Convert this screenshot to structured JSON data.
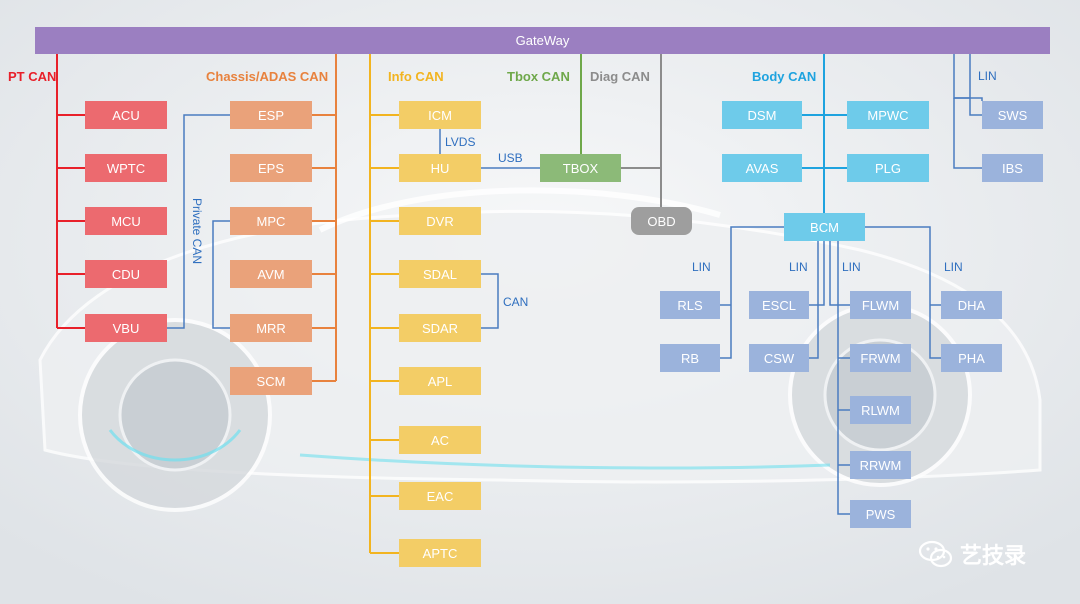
{
  "gateway": {
    "label": "GateWay"
  },
  "buses": {
    "pt_can": "PT CAN",
    "chassis_can": "Chassis/ADAS CAN",
    "info_can": "Info CAN",
    "tbox_can": "Tbox CAN",
    "diag_can": "Diag CAN",
    "body_can": "Body CAN",
    "lin": "LIN",
    "private_can": "Private CAN"
  },
  "links": {
    "lvds": "LVDS",
    "usb": "USB",
    "can": "CAN",
    "lin": "LIN"
  },
  "colors": {
    "gateway": "#9b7fc1",
    "pt": "#e8575b",
    "chassis": "#e89966",
    "info": "#f2c24a",
    "tbox": "#7fb069",
    "diag": "#8c8c8c",
    "body": "#5bc3e8",
    "lin": "#8fa8d6"
  },
  "nodes": {
    "acu": "ACU",
    "wptc": "WPTC",
    "mcu": "MCU",
    "cdu": "CDU",
    "vbu": "VBU",
    "esp": "ESP",
    "eps": "EPS",
    "mpc": "MPC",
    "avm": "AVM",
    "mrr": "MRR",
    "scm": "SCM",
    "icm": "ICM",
    "hu": "HU",
    "dvr": "DVR",
    "sdal": "SDAL",
    "sdar": "SDAR",
    "apl": "APL",
    "ac": "AC",
    "eac": "EAC",
    "aptc": "APTC",
    "tbox": "TBOX",
    "obd": "OBD",
    "dsm": "DSM",
    "mpwc": "MPWC",
    "avas": "AVAS",
    "plg": "PLG",
    "sws": "SWS",
    "ibs": "IBS",
    "bcm": "BCM",
    "rls": "RLS",
    "rb": "RB",
    "escl": "ESCL",
    "csw": "CSW",
    "flwm": "FLWM",
    "frwm": "FRWM",
    "rlwm": "RLWM",
    "rrwm": "RRWM",
    "pws": "PWS",
    "dha": "DHA",
    "pha": "PHA"
  },
  "watermark": {
    "text": "艺技录",
    "icon": "wechat-icon"
  }
}
